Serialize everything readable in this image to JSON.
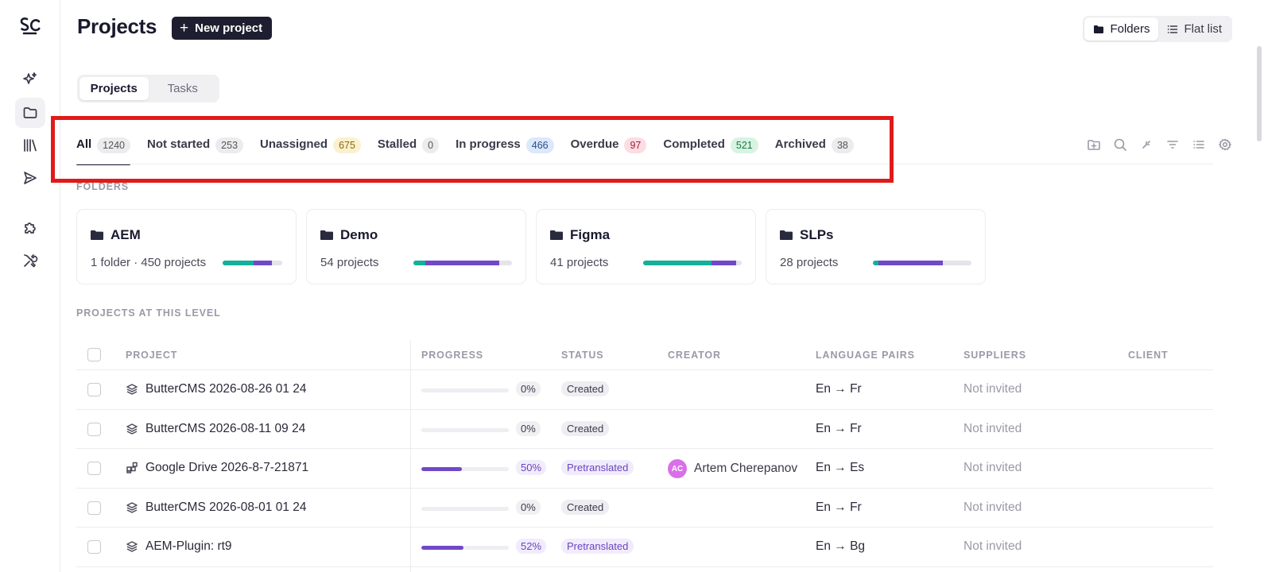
{
  "sidebar": {
    "logo": "Sc logo",
    "items": [
      {
        "icon": "sparkle-icon"
      },
      {
        "icon": "folder-icon",
        "active": true
      },
      {
        "icon": "library-icon"
      },
      {
        "icon": "send-icon"
      },
      {
        "icon": "puzzle-icon"
      },
      {
        "icon": "tools-icon"
      }
    ]
  },
  "header": {
    "title": "Projects",
    "new_project_label": "New project",
    "view_folders": "Folders",
    "view_flat": "Flat list"
  },
  "segment": {
    "projects": "Projects",
    "tasks": "Tasks"
  },
  "filter_tabs": [
    {
      "label": "All",
      "count": "1240"
    },
    {
      "label": "Not started",
      "count": "253"
    },
    {
      "label": "Unassigned",
      "count": "675"
    },
    {
      "label": "Stalled",
      "count": "0"
    },
    {
      "label": "In progress",
      "count": "466"
    },
    {
      "label": "Overdue",
      "count": "97"
    },
    {
      "label": "Completed",
      "count": "521"
    },
    {
      "label": "Archived",
      "count": "38"
    }
  ],
  "colors": {
    "badge_unassigned": "#fbf1cf",
    "badge_in_progress": "#dce8fb",
    "badge_overdue": "#fbdde3",
    "badge_completed": "#d8f3e2",
    "progress_teal": "#14b09a",
    "progress_purple": "#7048c8",
    "highlight": "#e01a1a"
  },
  "folders_label": "FOLDERS",
  "folders": [
    {
      "name": "AEM",
      "meta": "1 folder · 450 projects",
      "completed": 0.52,
      "in_progress": 0.3
    },
    {
      "name": "Demo",
      "meta": "54 projects",
      "completed": 0.12,
      "in_progress": 0.75
    },
    {
      "name": "Figma",
      "meta": "41 projects",
      "completed": 0.69,
      "in_progress": 0.25
    },
    {
      "name": "SLPs",
      "meta": "28 projects",
      "completed": 0.06,
      "in_progress": 0.65
    }
  ],
  "projects_label": "PROJECTS AT THIS LEVEL",
  "table": {
    "headers": {
      "project": "PROJECT",
      "progress": "PROGRESS",
      "status": "STATUS",
      "creator": "CREATOR",
      "language_pairs": "LANGUAGE PAIRS",
      "suppliers": "SUPPLIERS",
      "client": "CLIENT"
    },
    "rows": [
      {
        "name": "ButterCMS 2026-08-26 01 24",
        "icon": "layers-icon",
        "progress": "0%",
        "progress_value": 0,
        "status": "Created",
        "creator": "",
        "initials": "",
        "lang": "En → Fr",
        "suppliers": "Not invited"
      },
      {
        "name": "ButterCMS 2026-08-11 09 24",
        "icon": "layers-icon",
        "progress": "0%",
        "progress_value": 0,
        "status": "Created",
        "creator": "",
        "initials": "",
        "lang": "En → Fr",
        "suppliers": "Not invited"
      },
      {
        "name": "Google Drive 2026-8-7-21871",
        "icon": "integration-icon",
        "progress": "50%",
        "progress_value": 0.46,
        "status": "Pretranslated",
        "creator": "Artem Cherepanov",
        "initials": "AC",
        "lang": "En → Es",
        "suppliers": "Not invited"
      },
      {
        "name": "ButterCMS 2026-08-01 01 24",
        "icon": "layers-icon",
        "progress": "0%",
        "progress_value": 0,
        "status": "Created",
        "creator": "",
        "initials": "",
        "lang": "En → Fr",
        "suppliers": "Not invited"
      },
      {
        "name": "AEM-Plugin: rt9",
        "icon": "layers-icon",
        "progress": "52%",
        "progress_value": 0.48,
        "status": "Pretranslated",
        "creator": "",
        "initials": "",
        "lang": "En → Bg",
        "suppliers": "Not invited"
      }
    ]
  }
}
